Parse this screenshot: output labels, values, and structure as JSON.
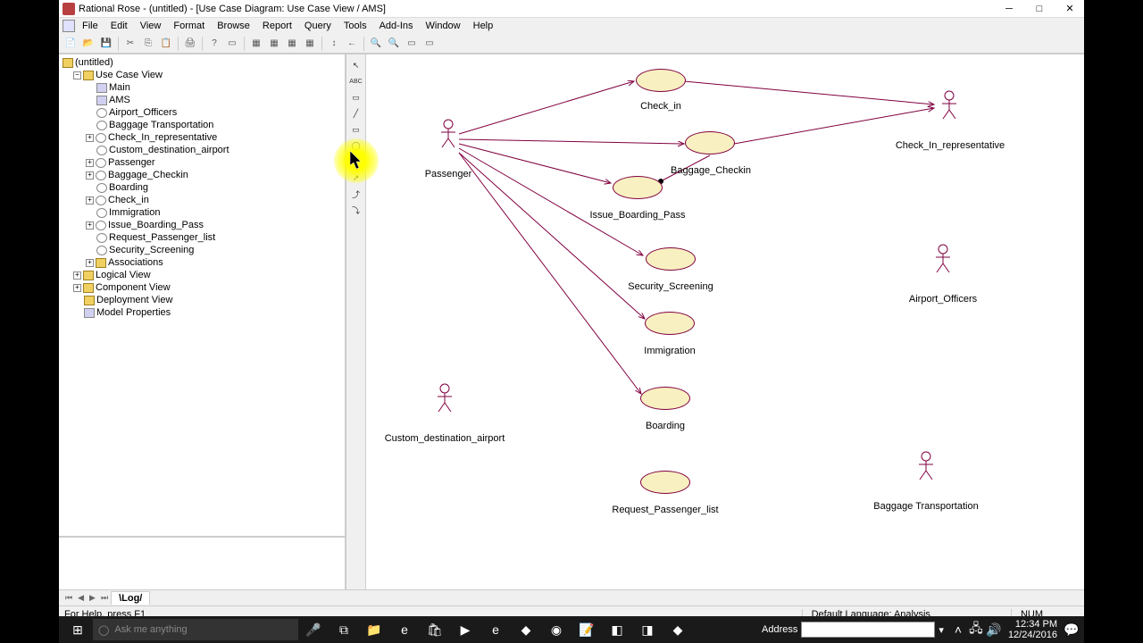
{
  "window": {
    "title": "Rational Rose - (untitled) - [Use Case Diagram: Use Case View / AMS]"
  },
  "menus": [
    "File",
    "Edit",
    "View",
    "Format",
    "Browse",
    "Report",
    "Query",
    "Tools",
    "Add-Ins",
    "Window",
    "Help"
  ],
  "tree": {
    "root": "(untitled)",
    "usecase_view": "Use Case View",
    "items": [
      "Main",
      "AMS",
      "Airport_Officers",
      "Baggage Transportation",
      "Check_In_representative",
      "Custom_destination_airport",
      "Passenger",
      "Baggage_Checkin",
      "Boarding",
      "Check_in",
      "Immigration",
      "Issue_Boarding_Pass",
      "Request_Passenger_list",
      "Security_Screening",
      "Associations"
    ],
    "logical": "Logical View",
    "component": "Component View",
    "deployment": "Deployment View",
    "modelprops": "Model Properties"
  },
  "diagram": {
    "actors": {
      "passenger": "Passenger",
      "checkin_rep": "Check_In_representative",
      "airport_off": "Airport_Officers",
      "custom_dest": "Custom_destination_airport",
      "baggage_trans": "Baggage Transportation"
    },
    "usecases": {
      "check_in": "Check_in",
      "baggage_checkin": "Baggage_Checkin",
      "issue_boarding": "Issue_Boarding_Pass",
      "security": "Security_Screening",
      "immigration": "Immigration",
      "boarding": "Boarding",
      "request_pl": "Request_Passenger_list"
    }
  },
  "tab": "Log",
  "status": {
    "help": "For Help, press F1",
    "lang": "Default Language: Analysis",
    "num": "NUM"
  },
  "taskbar": {
    "cortana": "Ask me anything",
    "address_label": "Address",
    "time": "12:34 PM",
    "date": "12/24/2016"
  }
}
